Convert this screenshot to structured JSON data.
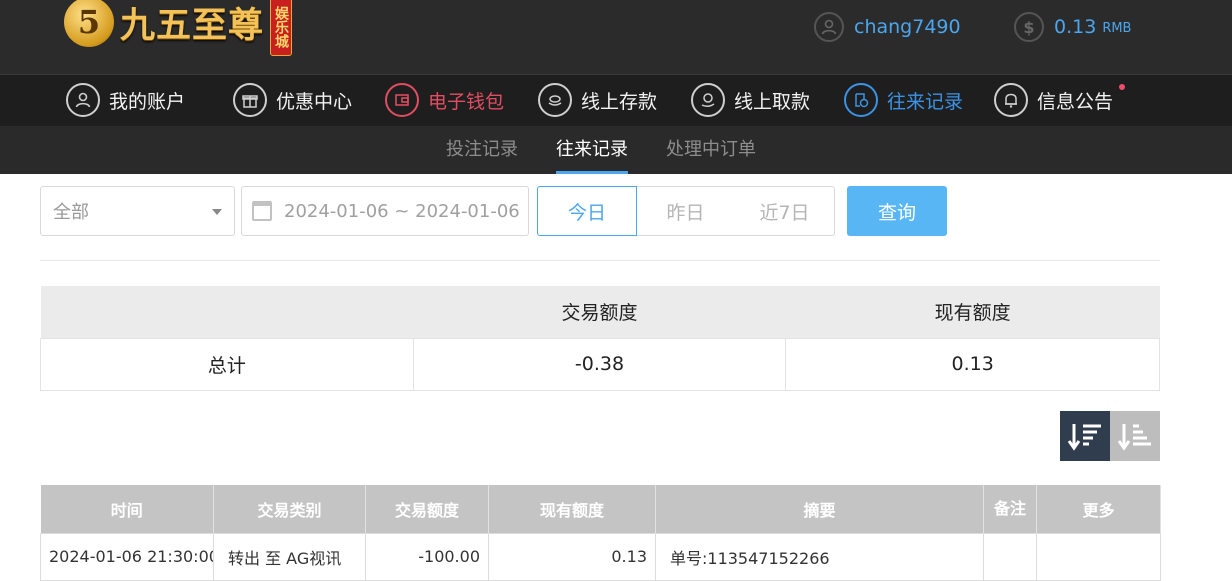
{
  "brand": {
    "name": "九五至尊",
    "tag": "娱乐城",
    "mark": "5"
  },
  "user": {
    "username": "chang7490",
    "balance": "0.13",
    "currency": "RMB"
  },
  "main_nav": [
    {
      "label": "我的账户",
      "icon": "user-icon"
    },
    {
      "label": "优惠中心",
      "icon": "gift-icon"
    },
    {
      "label": "电子钱包",
      "icon": "wallet-icon",
      "color": "#e34d62"
    },
    {
      "label": "线上存款",
      "icon": "deposit-icon"
    },
    {
      "label": "线上取款",
      "icon": "withdraw-icon"
    },
    {
      "label": "往来记录",
      "icon": "records-icon",
      "color": "#3b93e6"
    },
    {
      "label": "信息公告",
      "icon": "bell-icon"
    }
  ],
  "sub_nav": [
    {
      "label": "投注记录"
    },
    {
      "label": "往来记录",
      "active": true
    },
    {
      "label": "处理中订单"
    }
  ],
  "filter": {
    "type_selected": "全部",
    "date_range": "2024-01-06 ~ 2024-01-06",
    "quick_ranges": [
      "今日",
      "昨日",
      "近7日"
    ],
    "quick_active": "今日",
    "query_label": "查询"
  },
  "summary": {
    "headers": [
      "",
      "交易额度",
      "现有额度"
    ],
    "row": [
      "总计",
      "-0.38",
      "0.13"
    ]
  },
  "records": {
    "headers": [
      "时间",
      "交易类别",
      "交易额度",
      "现有额度",
      "摘要",
      "备注",
      "更多"
    ],
    "rows": [
      [
        "2024-01-06 21:30:00",
        "转出 至 AG视讯",
        "-100.00",
        "0.13",
        "单号:113547152266",
        "",
        ""
      ]
    ]
  },
  "colors": {
    "accent": "#4aa6ee",
    "query_button": "#58b6f5",
    "highlight": "#e34d62",
    "header_bg": "#2b2b2b"
  }
}
